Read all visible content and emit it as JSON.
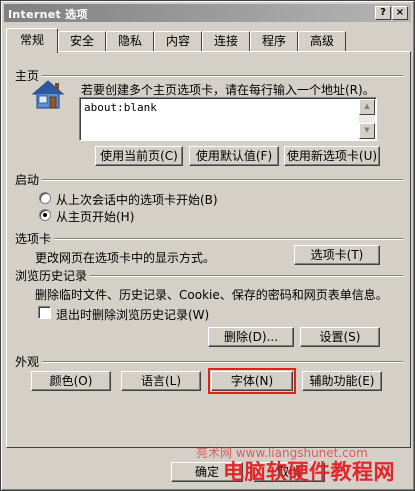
{
  "window": {
    "title": "Internet 选项",
    "help_label": "?",
    "close_label": "×"
  },
  "tabs": [
    {
      "label": "常规",
      "active": true
    },
    {
      "label": "安全"
    },
    {
      "label": "隐私"
    },
    {
      "label": "内容"
    },
    {
      "label": "连接"
    },
    {
      "label": "程序"
    },
    {
      "label": "高级"
    }
  ],
  "home": {
    "title": "主页",
    "hint": "若要创建多个主页选项卡，请在每行输入一个地址(R)。",
    "url": "about:blank",
    "use_current": "使用当前页(C)",
    "use_default": "使用默认值(F)",
    "use_new_tab": "使用新选项卡(U)"
  },
  "startup": {
    "title": "启动",
    "option_last": "从上次会话中的选项卡开始(B)",
    "option_home": "从主页开始(H)"
  },
  "tabs_section": {
    "title": "选项卡",
    "desc": "更改网页在选项卡中的显示方式。",
    "button": "选项卡(T)"
  },
  "history": {
    "title": "浏览历史记录",
    "desc": "删除临时文件、历史记录、Cookie、保存的密码和网页表单信息。",
    "checkbox": "退出时删除浏览历史记录(W)",
    "delete_button": "删除(D)...",
    "settings_button": "设置(S)"
  },
  "appearance": {
    "title": "外观",
    "colors": "颜色(O)",
    "languages": "语言(L)",
    "fonts": "字体(N)",
    "accessibility": "辅助功能(E)"
  },
  "footer": {
    "ok": "确定",
    "cancel": "取消"
  },
  "watermark": {
    "site": "亮术网 www.liangshunet.com",
    "brand": "电脑软硬件教程网"
  },
  "colors": {
    "highlight_box": "#e0201a",
    "watermark": "#e3262a"
  }
}
